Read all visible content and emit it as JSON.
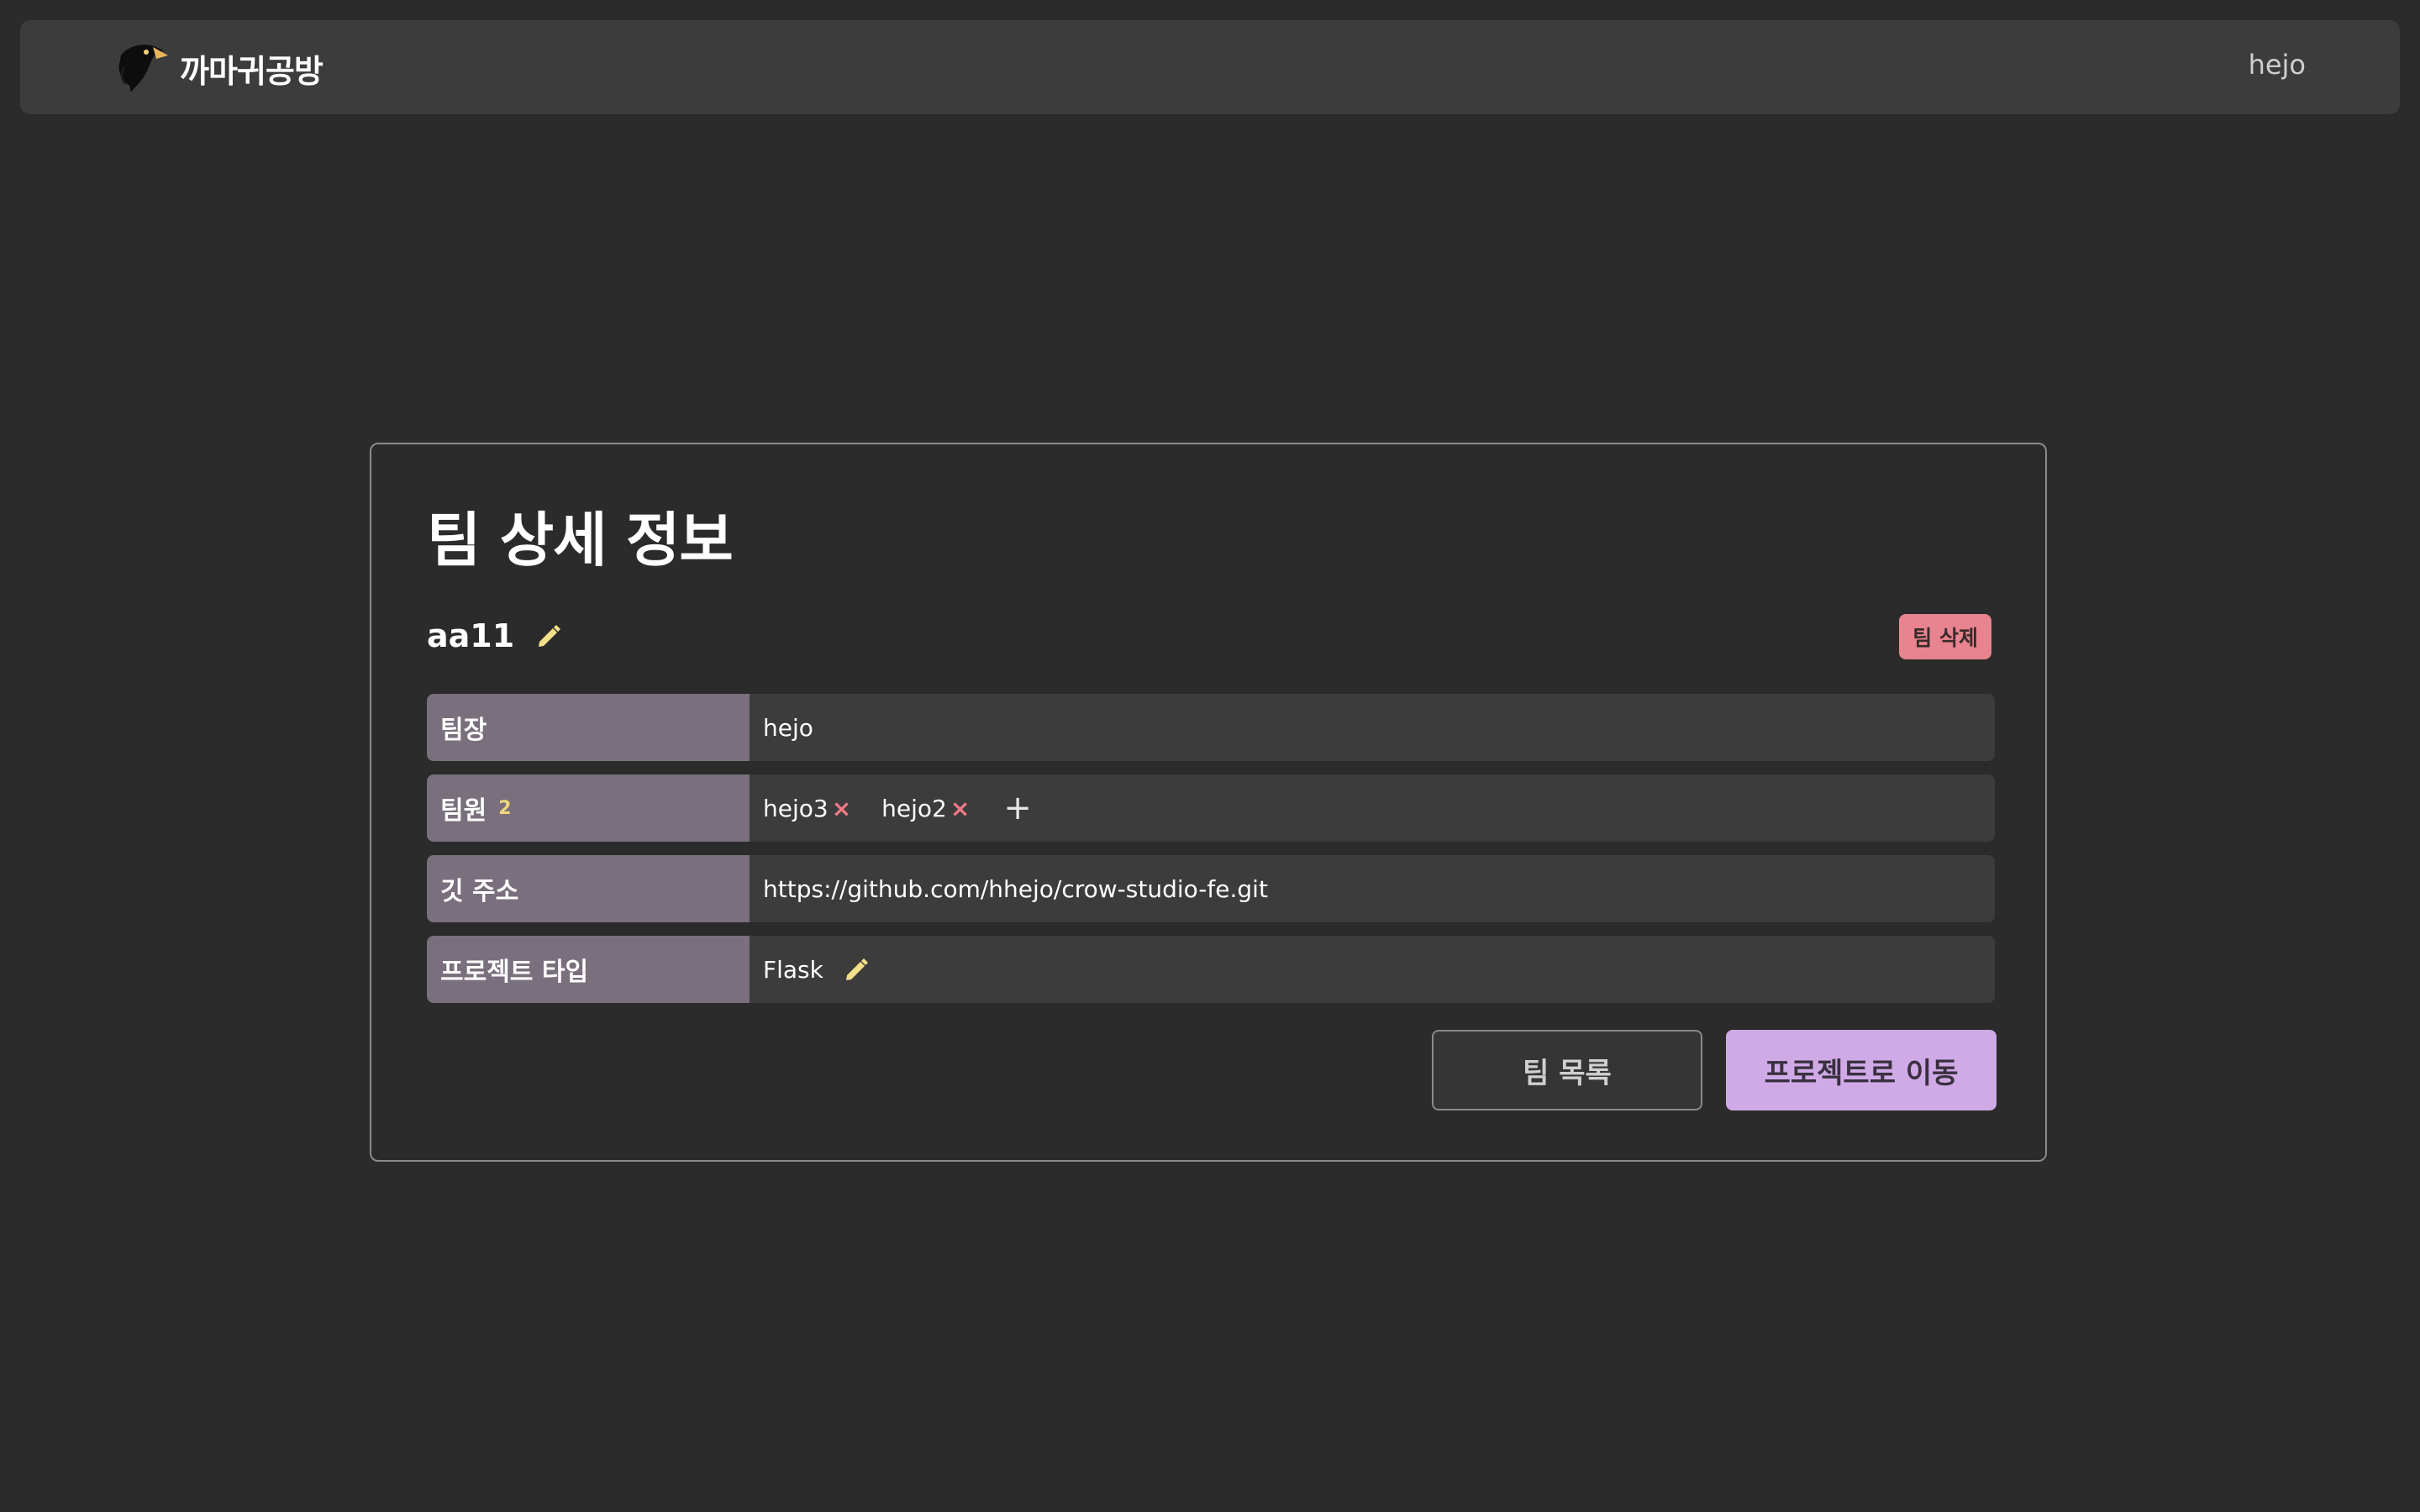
{
  "header": {
    "brand_name": "까마귀공방",
    "logo_icon": "crow-logo-icon",
    "user_name": "hejo"
  },
  "page": {
    "title": "팀 상세 정보",
    "team_name": "aa11",
    "delete_label": "팀 삭제"
  },
  "info": {
    "leader_label": "팀장",
    "leader_value": "hejo",
    "members_label": "팀원",
    "members_count": "2",
    "members": [
      {
        "name": "hejo3",
        "remove": "×"
      },
      {
        "name": "hejo2",
        "remove": "×"
      }
    ],
    "add_member": "+",
    "git_label": "깃 주소",
    "git_value": "https://github.com/hhejo/crow-studio-fe.git",
    "type_label": "프로젝트 타입",
    "type_value": "Flask"
  },
  "actions": {
    "team_list_label": "팀 목록",
    "go_project_label": "프로젝트로 이동"
  },
  "colors": {
    "background": "#2b2b2b",
    "bar": "#3c3c3c",
    "label_bg": "#7a6f7c",
    "delete": "#e8848f",
    "primary": "#cfaae6",
    "pencil": "#f5e08a",
    "remove": "#f07a86"
  }
}
